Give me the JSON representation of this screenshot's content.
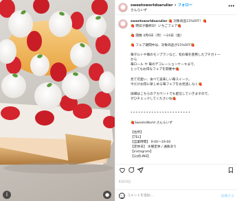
{
  "post": {
    "username": "sweetsworldsarulier",
    "separator": "•",
    "follow_label": "フォロー",
    "subtitle": "さんらいず"
  },
  "caption": {
    "username": "sweetsworldsarulier",
    "lines": [
      "🍓 対象商品15%OFF！🍓",
      "🍓 明日が最終日！いちごフェア🍓",
      "",
      "🍓 開催 4月6日（月）〜24日（金）",
      "",
      "🍓 フェア期間中は、対象商品が15%OFF🍓",
      "",
      "苺タルトや苺のモンブランなど、旬の苺を使用したプチガトー",
      "から",
      "苺ロール や 苺のデコレーションケーキまで、",
      "とってもお得なフェアを開催中🍓",
      "",
      "見て可愛い、食べて美味しい苺スイーツ。",
      "今だけお得に楽しめる苺フェアをお見逃しなく🍓",
      "",
      "詳細はこちらのアカウントでも配信していきますので、",
      "ぜひチェックしてくださいね🍓",
      "",
      "",
      "* * * * * * * * * * * * * * * * * * * * * * *",
      "",
      "🍓SweetsWorld さんらいず",
      "",
      "【住所】",
      "【TEL】",
      "【営業時間】 9:00〜19:00",
      "【定休日】 水曜定休 / 通販あり",
      "【instagram】",
      "【公式LINE】"
    ]
  },
  "footer": {
    "date": "4月23日",
    "likes": "",
    "comment_placeholder": "コメントを追加...",
    "post_label": "投稿する"
  },
  "icons": {
    "like": "heart-icon",
    "comment": "comment-icon",
    "share": "share-icon",
    "save": "bookmark-icon",
    "more": "more-icon",
    "emoji": "emoji-icon",
    "info": "info-icon",
    "tag": "tag-icon"
  },
  "colors": {
    "accent": "#0095f6",
    "text": "#262626",
    "muted": "#8e8e8e",
    "border": "#efefef",
    "strawberry": "#d4242d"
  }
}
